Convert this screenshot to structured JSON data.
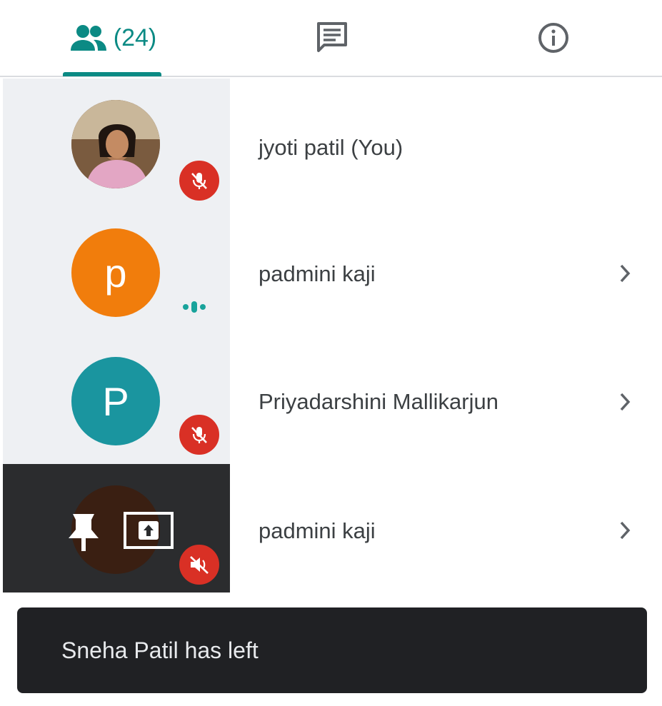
{
  "tabs": {
    "people_count": "(24)",
    "active": "people",
    "accent": "#0b8a84",
    "icons": {
      "people": "people-icon",
      "chat": "chat-icon",
      "info": "info-icon"
    }
  },
  "participants": [
    {
      "name": "jyoti patil (You)",
      "avatar": "photo",
      "status": "mic-muted"
    },
    {
      "initial": "p",
      "name": "padmini kaji",
      "avatar_color": "#f17d0c",
      "status": "speaking",
      "has_chevron": true
    },
    {
      "initial": "P",
      "name": "Priyadarshini Mallikarjun",
      "avatar_color": "#1a959f",
      "status": "mic-muted",
      "has_chevron": true
    },
    {
      "name": "padmini kaji",
      "status": "audio-muted",
      "overlay_icons": [
        "pin-icon",
        "present-screen-icon"
      ],
      "has_chevron": true
    }
  ],
  "toast": {
    "message": "Sneha Patil has left"
  },
  "colors": {
    "muted_badge": "#d93025",
    "speaking": "#18a39b",
    "text": "#3c4043"
  }
}
